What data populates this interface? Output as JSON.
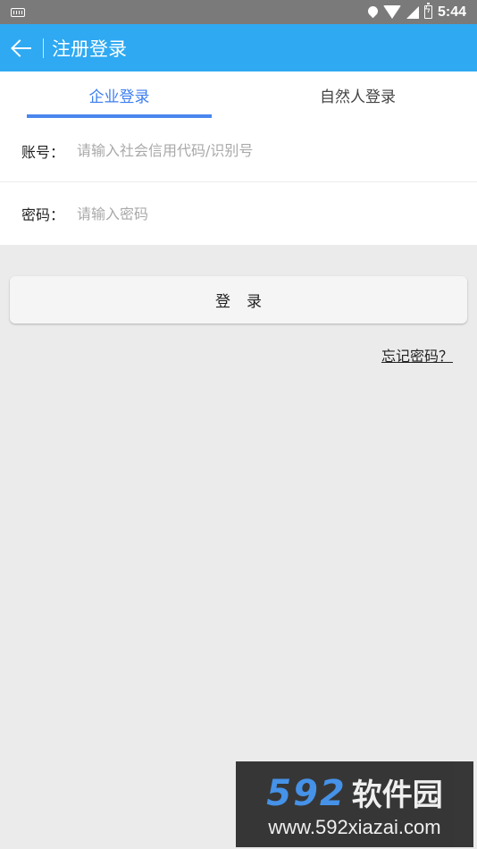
{
  "status_bar": {
    "time": "5:44",
    "icons": [
      "keyboard-icon",
      "location-icon",
      "wifi-icon",
      "signal-icon",
      "battery-charging-icon"
    ]
  },
  "app_bar": {
    "title": "注册登录",
    "back_icon": "arrow-left-icon",
    "background": "#2ea9f2"
  },
  "tabs": [
    {
      "label": "企业登录",
      "active": true
    },
    {
      "label": "自然人登录",
      "active": false
    }
  ],
  "tab_accent": "#4a86ee",
  "form": {
    "account": {
      "label": "账号：",
      "placeholder": "请输入社会信用代码/识别号",
      "value": ""
    },
    "password": {
      "label": "密码：",
      "placeholder": "请输入密码",
      "value": ""
    }
  },
  "login_button": {
    "label": "登录"
  },
  "forgot_link": {
    "label": "忘记密码？"
  },
  "watermark": {
    "logo_num": "592",
    "logo_text": "软件园",
    "url": "www.592xiazai.com"
  }
}
